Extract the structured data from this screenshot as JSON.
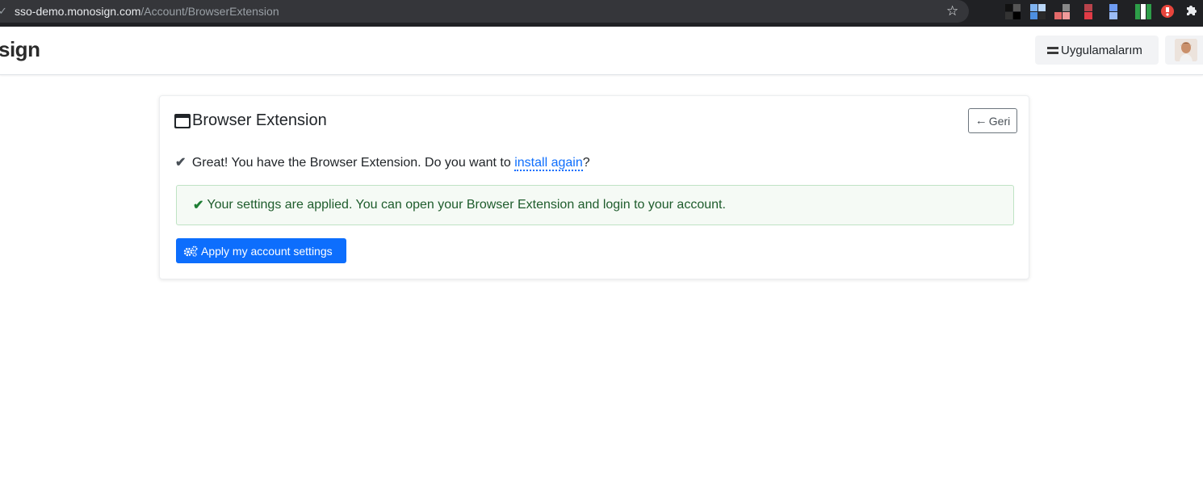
{
  "browser": {
    "url_host": "sso-demo.monosign.com",
    "url_path": "/Account/BrowserExtension",
    "star_icon": "star-icon",
    "extensions": [
      {
        "name": "extension-1-icon",
        "color": "#111111"
      },
      {
        "name": "extension-2-icon",
        "color": "#7fb3f0"
      },
      {
        "name": "extension-3-icon",
        "color": "#e36a6a"
      },
      {
        "name": "extension-4-icon",
        "color": "#d93b3b"
      },
      {
        "name": "extension-5-icon",
        "color": "#6e9cf2"
      },
      {
        "name": "extension-6-icon",
        "color": "#2e9e49"
      },
      {
        "name": "extension-7-icon",
        "color": "#e8453c"
      }
    ],
    "puzzle_icon": "puzzle-icon"
  },
  "navbar": {
    "logo_text": "sign",
    "apps_label": "Uygulamalarım",
    "apps_icon": "hamburger-icon",
    "avatar_icon": "avatar"
  },
  "card": {
    "title": "Browser Extension",
    "title_icon": "window-icon",
    "back_label": "Geri",
    "status_text": "Great! You have the Browser Extension. Do you want to",
    "install_link": "install again",
    "status_suffix": "?",
    "alert_text": "Your settings are applied. You can open your Browser Extension and login to your account.",
    "apply_label": "Apply my account settings"
  },
  "colors": {
    "primary": "#0d6efd",
    "success_text": "#1e5c2c",
    "success_bg": "#f5faf5",
    "success_border": "#bfe3c4"
  }
}
